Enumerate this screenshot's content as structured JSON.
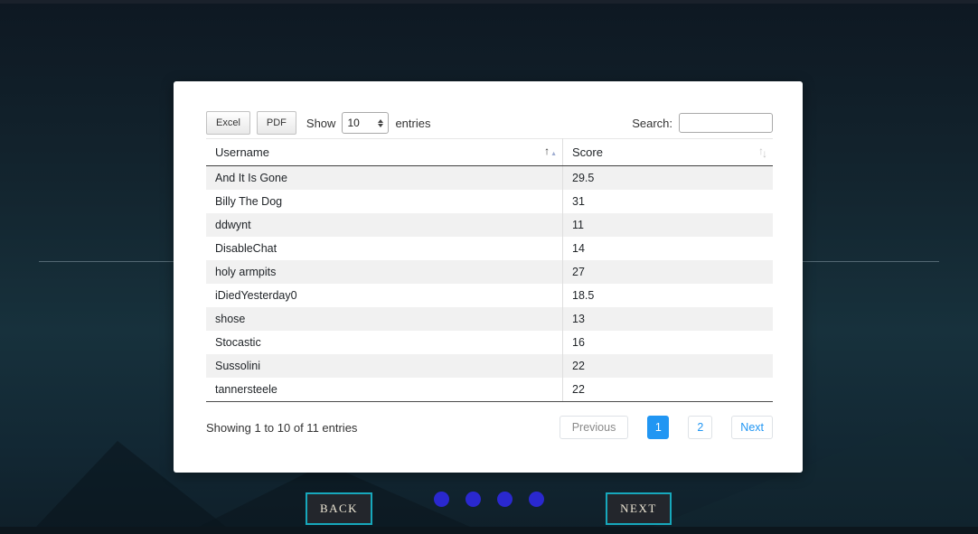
{
  "toolbar": {
    "excel_label": "Excel",
    "pdf_label": "PDF",
    "show_label": "Show",
    "page_size": "10",
    "entries_label": "entries",
    "search_label": "Search:",
    "search_value": ""
  },
  "table": {
    "columns": [
      {
        "label": "Username",
        "sort": "ascending"
      },
      {
        "label": "Score",
        "sort": "none"
      }
    ],
    "rows": [
      {
        "username": "And It Is Gone",
        "score": "29.5"
      },
      {
        "username": "Billy The Dog",
        "score": "31"
      },
      {
        "username": "ddwynt",
        "score": "11"
      },
      {
        "username": "DisableChat",
        "score": "14"
      },
      {
        "username": "holy armpits",
        "score": "27"
      },
      {
        "username": "iDiedYesterday0",
        "score": "18.5"
      },
      {
        "username": "shose",
        "score": "13"
      },
      {
        "username": "Stocastic",
        "score": "16"
      },
      {
        "username": "Sussolini",
        "score": "22"
      },
      {
        "username": "tannersteele",
        "score": "22"
      }
    ]
  },
  "footer": {
    "info": "Showing 1 to 10 of 11 entries",
    "pagination": [
      {
        "label": "Previous",
        "state": "disabled"
      },
      {
        "label": "1",
        "state": "active"
      },
      {
        "label": "2",
        "state": "normal"
      },
      {
        "label": "Next",
        "state": "normal"
      }
    ]
  },
  "nav": {
    "back_label": "BACK",
    "next_label": "NEXT",
    "dot_count": 4
  },
  "colors": {
    "accent_blue": "#2196f3",
    "dot_blue": "#2a28cf",
    "teal_border": "#17a8bc"
  }
}
